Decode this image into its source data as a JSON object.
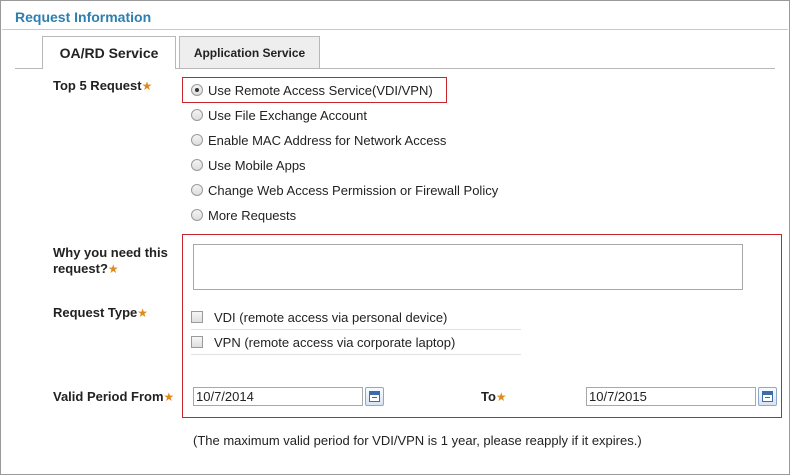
{
  "section": {
    "title": "Request Information"
  },
  "tabs": [
    {
      "label": "OA/RD Service",
      "active": true
    },
    {
      "label": "Application Service",
      "active": false
    }
  ],
  "required_marker": "★",
  "top5": {
    "label": "Top 5 Request",
    "options": [
      {
        "label": "Use Remote Access Service(VDI/VPN)",
        "selected": true
      },
      {
        "label": "Use File Exchange Account",
        "selected": false
      },
      {
        "label": "Enable MAC Address for Network Access",
        "selected": false
      },
      {
        "label": "Use Mobile Apps",
        "selected": false
      },
      {
        "label": "Change Web Access Permission or Firewall Policy",
        "selected": false
      },
      {
        "label": "More Requests",
        "selected": false
      }
    ]
  },
  "reason": {
    "label_line1": "Why you need this",
    "label_line2": "request?",
    "value": ""
  },
  "request_type": {
    "label": "Request Type",
    "options": [
      {
        "label": "VDI (remote access via personal device)",
        "checked": false
      },
      {
        "label": "VPN (remote access via corporate laptop)",
        "checked": false
      }
    ]
  },
  "valid_period": {
    "from_label": "Valid Period From",
    "from_value": "10/7/2014",
    "to_label": "To",
    "to_value": "10/7/2015"
  },
  "footnote": "(The maximum valid period for VDI/VPN is 1 year, please reapply if it expires.)",
  "colors": {
    "title": "#2c7fae",
    "required_star": "#e08a1c",
    "highlight_border": "#c8252c"
  },
  "icons": {
    "calendar": "calendar-icon"
  }
}
